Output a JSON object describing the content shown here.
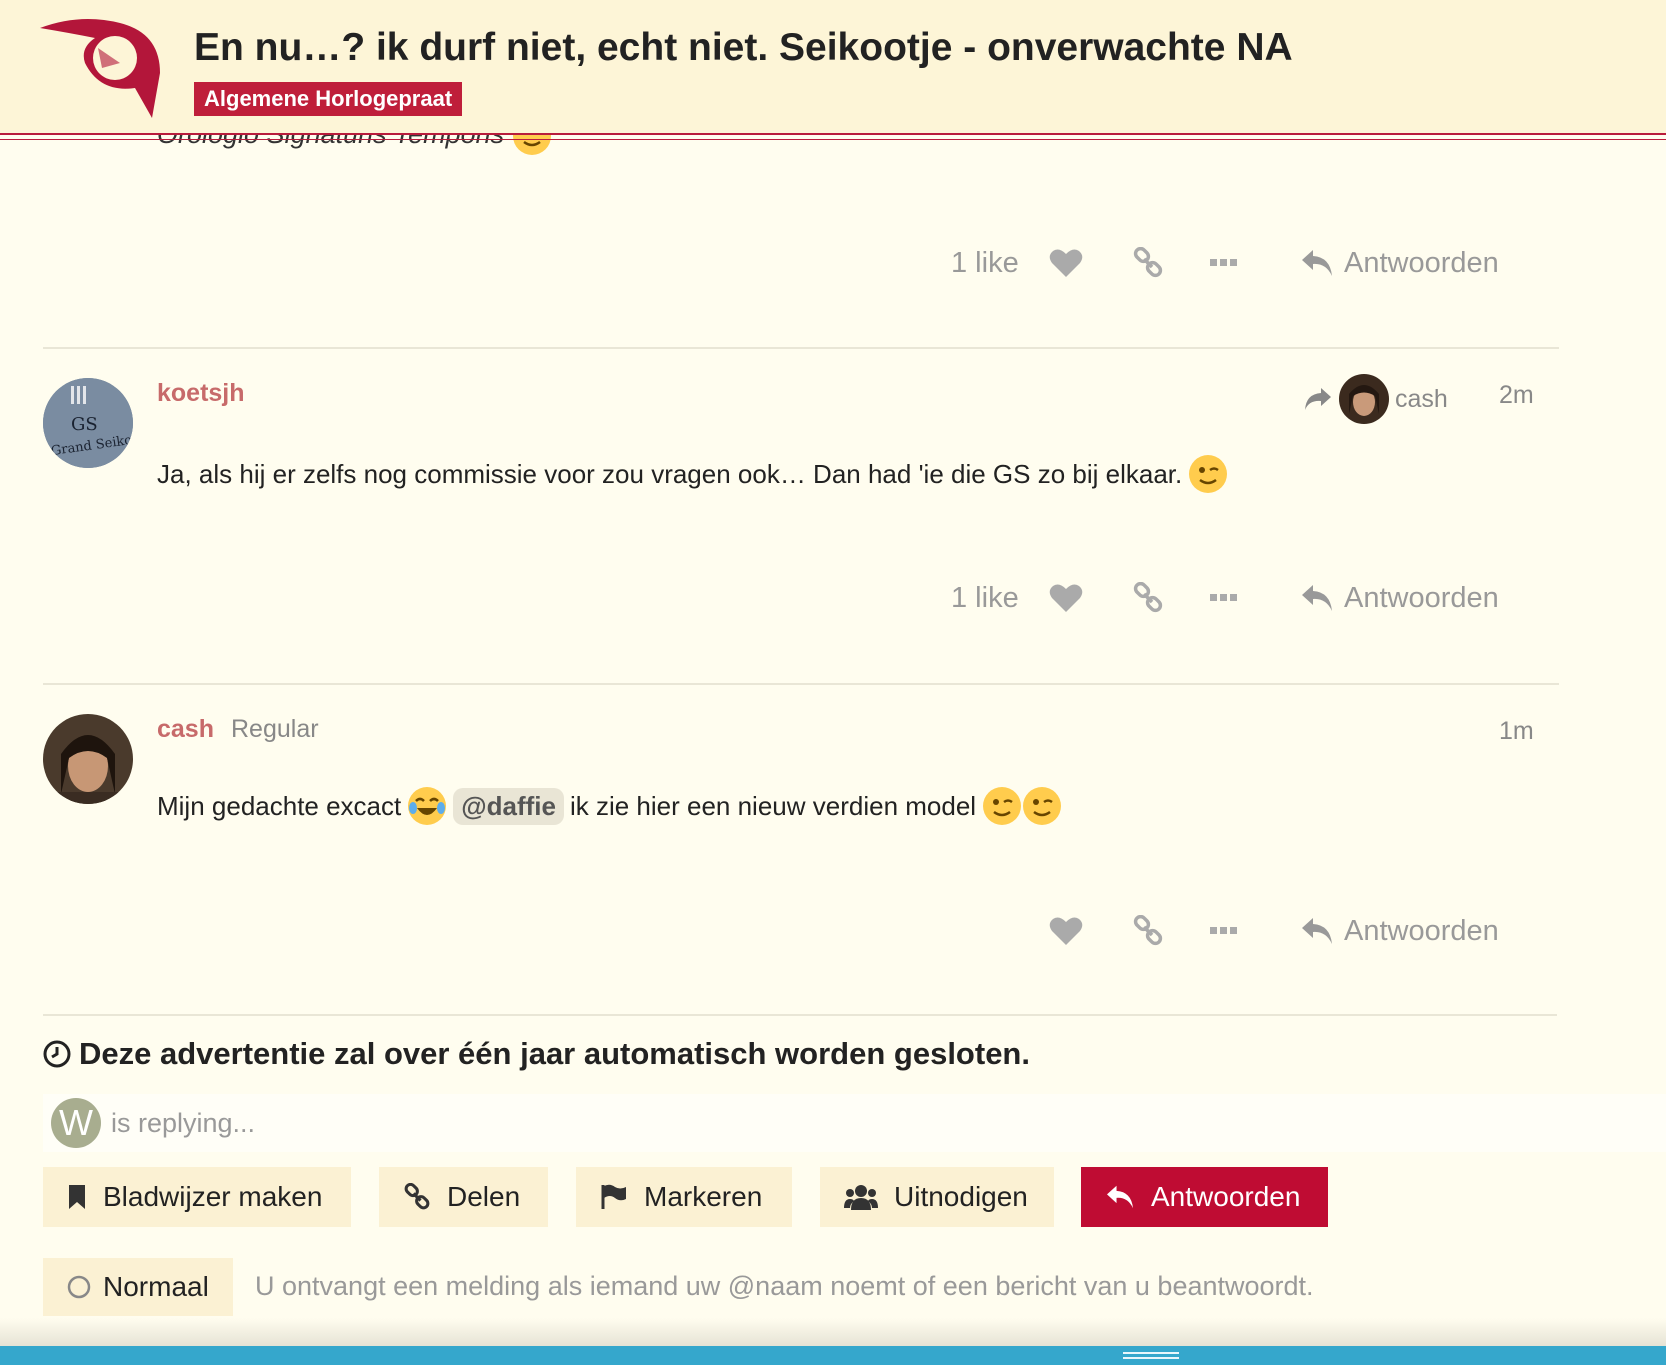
{
  "header": {
    "title": "En nu…? ik durf niet, echt niet. Seikootje - onverwachte NA",
    "category": "Algemene Horlogepraat"
  },
  "previous_post": {
    "partial_signature": "Orologio Signaturis Temporis",
    "like_count": "1 like",
    "reply_label": "Antwoorden"
  },
  "posts": [
    {
      "username": "koetsjh",
      "reply_to_user": "cash",
      "time": "2m",
      "body": "Ja, als hij er zelfs nog commissie voor zou vragen ook… Dan had 'ie die GS zo bij elkaar.",
      "avatar_text_1": "GS",
      "avatar_text_2": "Grand Seiko",
      "like_count": "1 like",
      "reply_label": "Antwoorden"
    },
    {
      "username": "cash",
      "user_title": "Regular",
      "time": "1m",
      "body_before": "Mijn gedachte excact",
      "mention": "@daffie",
      "body_after": "ik zie hier een nieuw verdien model",
      "reply_label": "Antwoorden"
    }
  ],
  "closing_notice": "Deze advertentie zal over één jaar automatisch worden gesloten.",
  "replying": {
    "avatar_letter": "W",
    "text": "is replying..."
  },
  "actions": {
    "bookmark": "Bladwijzer maken",
    "share": "Delen",
    "flag": "Markeren",
    "invite": "Uitnodigen",
    "reply": "Antwoorden"
  },
  "notification": {
    "level": "Normaal",
    "description": "U ontvangt een melding als iemand uw @naam noemt of een bericht van u beantwoordt."
  },
  "colors": {
    "accent": "#bf0c33",
    "username": "#c76a6a",
    "background": "#fffdef",
    "bottom_bar": "#35a7cc"
  },
  "icons": [
    "heart-icon",
    "link-icon",
    "ellipsis-icon",
    "reply-icon",
    "share-arrow-icon",
    "clock-icon",
    "bookmark-icon",
    "flag-icon",
    "users-icon",
    "circle-icon"
  ]
}
